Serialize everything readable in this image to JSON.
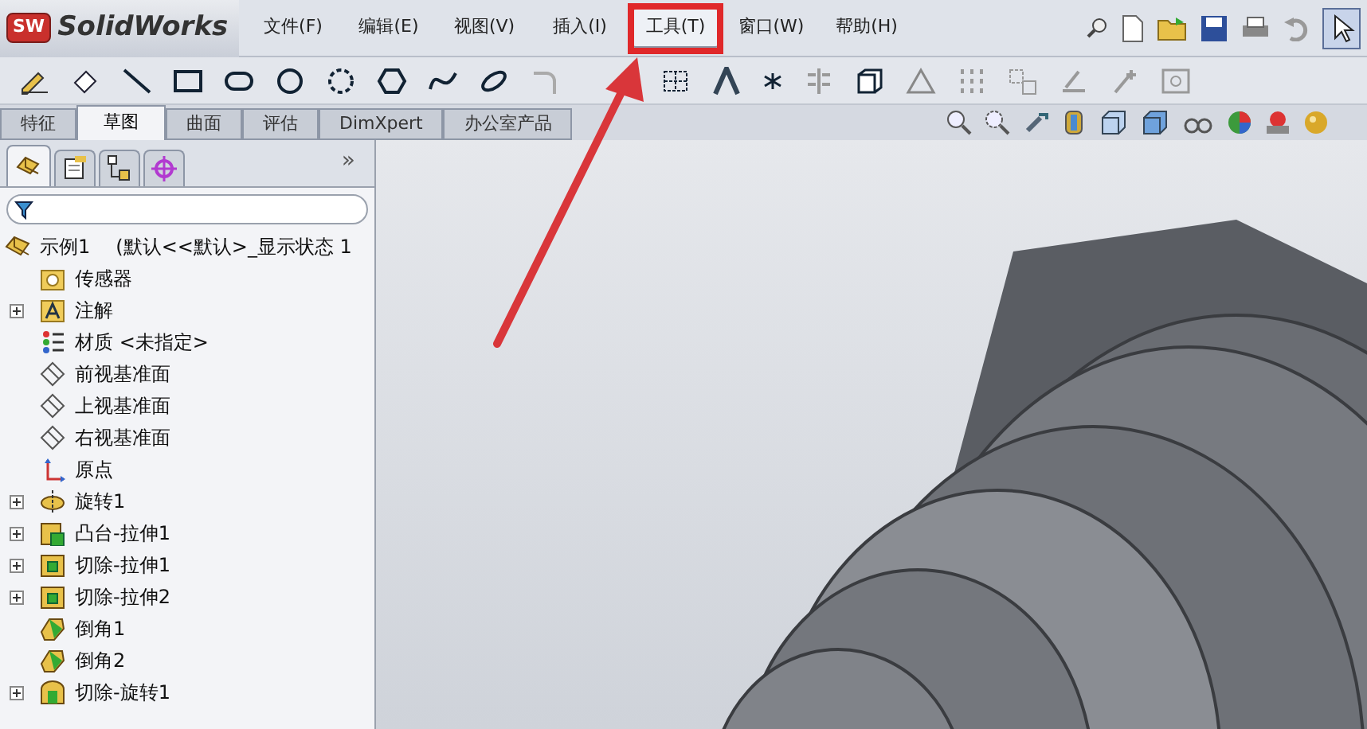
{
  "app": {
    "logo_badge": "SW",
    "title": "SolidWorks"
  },
  "menu": [
    {
      "label": "文件(F)",
      "selected": false
    },
    {
      "label": "编辑(E)",
      "selected": false
    },
    {
      "label": "视图(V)",
      "selected": false
    },
    {
      "label": "插入(I)",
      "selected": false
    },
    {
      "label": "工具(T)",
      "selected": true
    },
    {
      "label": "窗口(W)",
      "selected": false
    },
    {
      "label": "帮助(H)",
      "selected": false
    }
  ],
  "command_tabs": [
    {
      "label": "特征",
      "selected": false
    },
    {
      "label": "草图",
      "selected": true
    },
    {
      "label": "曲面",
      "selected": false
    },
    {
      "label": "评估",
      "selected": false
    },
    {
      "label": "DimXpert",
      "selected": false
    },
    {
      "label": "办公室产品",
      "selected": false
    }
  ],
  "panel_tabs": [
    {
      "kind": "feature",
      "selected": true
    },
    {
      "kind": "property",
      "selected": false
    },
    {
      "kind": "config",
      "selected": false
    },
    {
      "kind": "target",
      "selected": false
    }
  ],
  "panel_more": "»",
  "tree": {
    "label": "示例1",
    "detail": "(默认<<默认>_显示状态 1",
    "children": [
      {
        "label": "传感器",
        "kind": "sensor",
        "expandable": false
      },
      {
        "label": "注解",
        "kind": "annotation",
        "expandable": true
      },
      {
        "label": "材质 <未指定>",
        "kind": "material",
        "expandable": false
      },
      {
        "label": "前视基准面",
        "kind": "plane",
        "expandable": false
      },
      {
        "label": "上视基准面",
        "kind": "plane",
        "expandable": false
      },
      {
        "label": "右视基准面",
        "kind": "plane",
        "expandable": false
      },
      {
        "label": "原点",
        "kind": "origin",
        "expandable": false
      },
      {
        "label": "旋转1",
        "kind": "revolve",
        "expandable": true
      },
      {
        "label": "凸台-拉伸1",
        "kind": "boss",
        "expandable": true
      },
      {
        "label": "切除-拉伸1",
        "kind": "cut",
        "expandable": true
      },
      {
        "label": "切除-拉伸2",
        "kind": "cut",
        "expandable": true
      },
      {
        "label": "倒角1",
        "kind": "chamfer",
        "expandable": false
      },
      {
        "label": "倒角2",
        "kind": "chamfer",
        "expandable": false
      },
      {
        "label": "切除-旋转1",
        "kind": "cutrevolve",
        "expandable": true
      }
    ]
  }
}
